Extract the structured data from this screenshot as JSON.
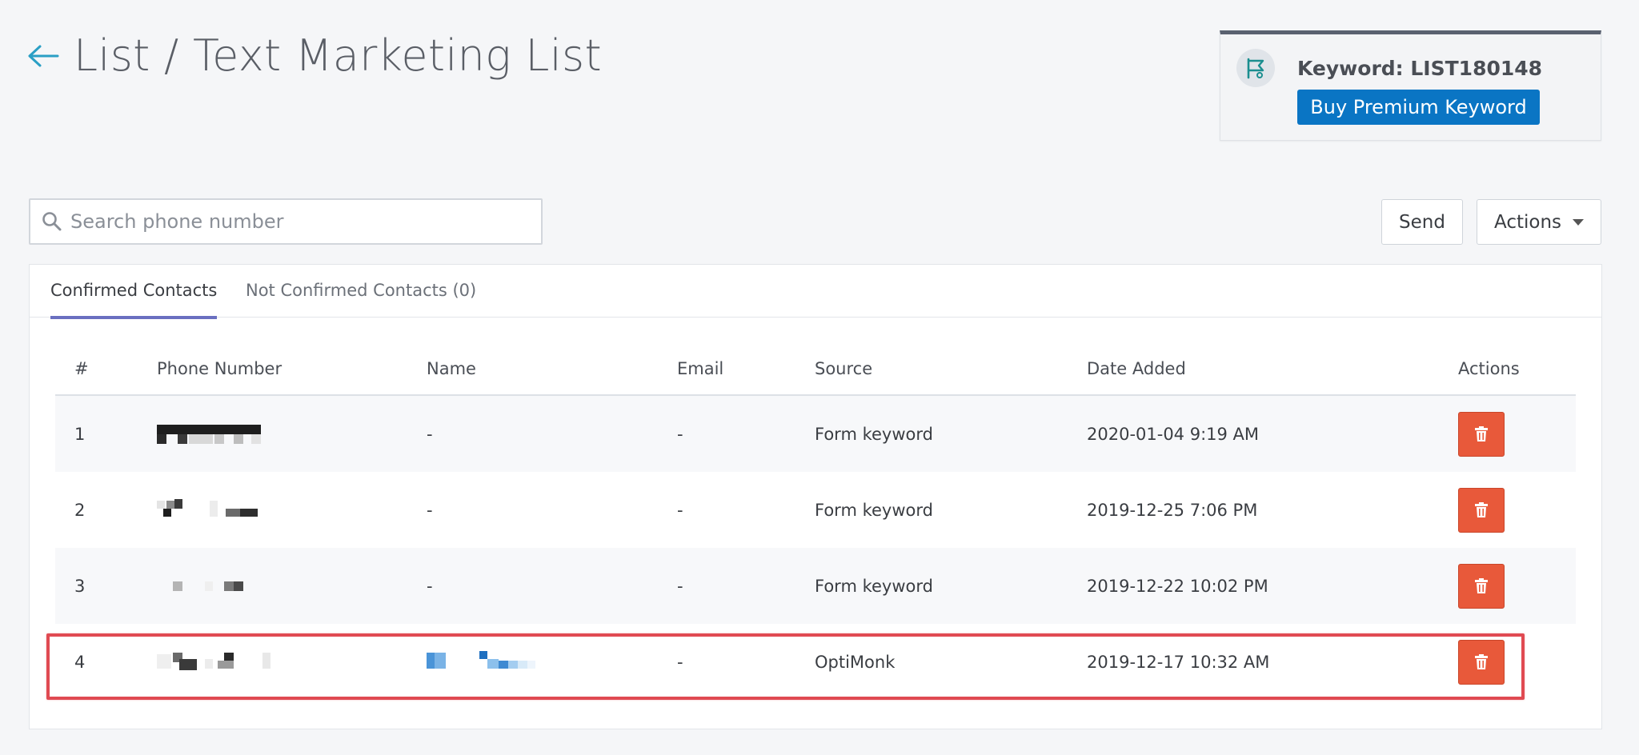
{
  "header": {
    "title": "List / Text Marketing List",
    "back_icon": "back-arrow-icon"
  },
  "keyword_card": {
    "label": "Keyword: LIST180148",
    "button_label": "Buy Premium Keyword",
    "icon": "flag-icon",
    "accent": "#0a75c4"
  },
  "search": {
    "placeholder": "Search phone number",
    "value": ""
  },
  "toolbar": {
    "send_label": "Send",
    "actions_label": "Actions"
  },
  "tabs": [
    {
      "label": "Confirmed Contacts",
      "active": true
    },
    {
      "label": "Not Confirmed Contacts (0)",
      "active": false
    }
  ],
  "table": {
    "columns": [
      "#",
      "Phone Number",
      "Name",
      "Email",
      "Source",
      "Date Added",
      "Actions"
    ],
    "rows": [
      {
        "num": "1",
        "name": "-",
        "email": "-",
        "source": "Form keyword",
        "date": "2020-01-04 9:19 AM"
      },
      {
        "num": "2",
        "name": "-",
        "email": "-",
        "source": "Form keyword",
        "date": "2019-12-25 7:06 PM"
      },
      {
        "num": "3",
        "name": "-",
        "email": "-",
        "source": "Form keyword",
        "date": "2019-12-22 10:02 PM"
      },
      {
        "num": "4",
        "name": "",
        "email": "-",
        "source": "OptiMonk",
        "date": "2019-12-17 10:32 AM"
      }
    ]
  },
  "colors": {
    "delete_button": "#e8593a",
    "highlight": "#e04a52",
    "tab_underline": "#6a6fc0"
  }
}
